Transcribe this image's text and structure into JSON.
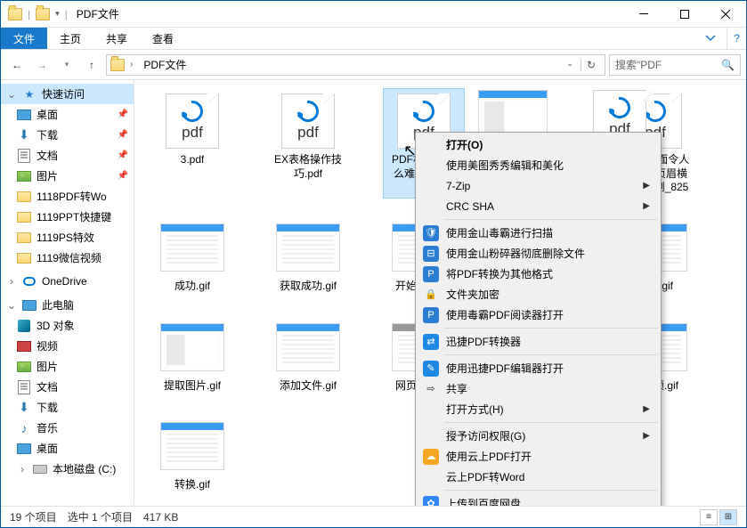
{
  "window": {
    "title": "PDF文件"
  },
  "ribbon": {
    "file": "文件",
    "home": "主页",
    "share": "共享",
    "view": "查看"
  },
  "address": {
    "crumb": "PDF文件"
  },
  "search": {
    "placeholder": "搜索\"PDF"
  },
  "sidebar": {
    "quick": "快速访问",
    "items": [
      "桌面",
      "下载",
      "文档",
      "图片",
      "1118PDF转Wo",
      "1119PPT快捷键",
      "1119PS特效",
      "1119微信视频"
    ],
    "onedrive": "OneDrive",
    "thispc": "此电脑",
    "pcitems": [
      "3D 对象",
      "视频",
      "图片",
      "文档",
      "下载",
      "音乐",
      "桌面",
      "本地磁盘 (C:)"
    ]
  },
  "files": {
    "r1": [
      "3.pdf",
      "EX表格操作技巧.pdf",
      "PDF格式为什么难编辑.pdf",
      "",
      "Word里面令人讨厌的页眉横线怎么删_8259.pdf"
    ],
    "r2": [
      "成功.gif",
      "获取成功.gif",
      "开始获取.gif",
      "",
      "扫描.gif"
    ],
    "r3": [
      "提取图片.gif",
      "添加文件.gif",
      "网页打开.gif",
      "",
      "音视频.gif"
    ],
    "r4": [
      "转换.gif"
    ]
  },
  "menu": {
    "open": "打开(O)",
    "meitu": "使用美图秀秀编辑和美化",
    "7zip": "7-Zip",
    "crc": "CRC SHA",
    "scan": "使用金山毒霸进行扫描",
    "shred": "使用金山粉碎器彻底删除文件",
    "convert": "将PDF转换为其他格式",
    "encrypt": "文件夹加密",
    "reader": "使用毒霸PDF阅读器打开",
    "xunjie": "迅捷PDF转换器",
    "xjedit": "使用迅捷PDF编辑器打开",
    "share": "共享",
    "openwith": "打开方式(H)",
    "access": "授予访问权限(G)",
    "cloud": "使用云上PDF打开",
    "cloudword": "云上PDF转Word",
    "baidu": "上传到百度网盘"
  },
  "status": {
    "count": "19 个项目",
    "sel": "选中 1 个项目",
    "size": "417 KB"
  }
}
